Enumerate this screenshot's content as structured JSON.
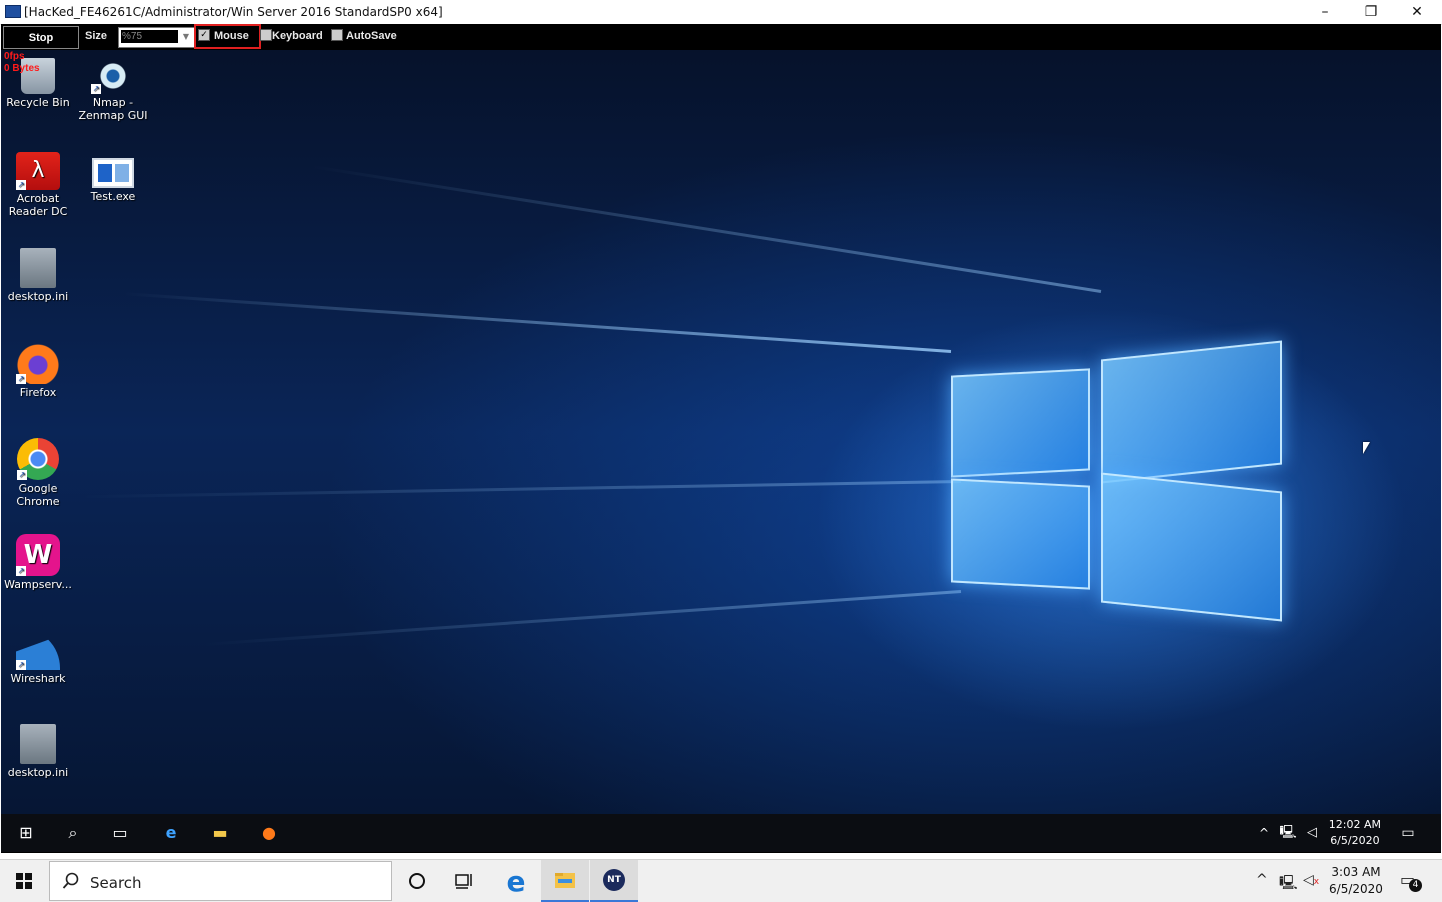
{
  "window": {
    "title": "[HacKed_FE46261C/Administrator/Win Server 2016 StandardSP0 x64]",
    "minimize": "–",
    "maximize": "❐",
    "close": "✕"
  },
  "toolbar": {
    "stop_label": "Stop",
    "size_label": "Size",
    "size_value": "%75",
    "mouse_label": "Mouse",
    "mouse_checked": true,
    "keyboard_label": "Keyboard",
    "keyboard_checked": false,
    "autosave_label": "AutoSave",
    "autosave_checked": false,
    "highlight_color": "#e02020"
  },
  "stats": {
    "fps": "0fps",
    "bytes": "0 Bytes"
  },
  "desktop_icons": [
    {
      "label": "Recycle Bin",
      "icon": "recycle-bin-icon"
    },
    {
      "label": "Nmap - Zenmap GUI",
      "icon": "nmap-eye-icon"
    },
    {
      "label": "Acrobat Reader DC",
      "icon": "acrobat-icon"
    },
    {
      "label": "Test.exe",
      "icon": "exe-window-icon"
    },
    {
      "label": "desktop.ini",
      "icon": "settings-file-icon"
    },
    {
      "label": "Firefox",
      "icon": "firefox-icon"
    },
    {
      "label": "Google Chrome",
      "icon": "chrome-icon"
    },
    {
      "label": "Wampserv...",
      "icon": "wamp-icon"
    },
    {
      "label": "Wireshark",
      "icon": "wireshark-fin-icon"
    },
    {
      "label": "desktop.ini",
      "icon": "settings-file-icon"
    }
  ],
  "remote_taskbar": {
    "time": "12:02 AM",
    "date": "6/5/2020"
  },
  "taskbar": {
    "search_placeholder": "Search",
    "time": "3:03 AM",
    "date": "6/5/2020",
    "notification_count": "4",
    "accent": "#3a78d8"
  }
}
